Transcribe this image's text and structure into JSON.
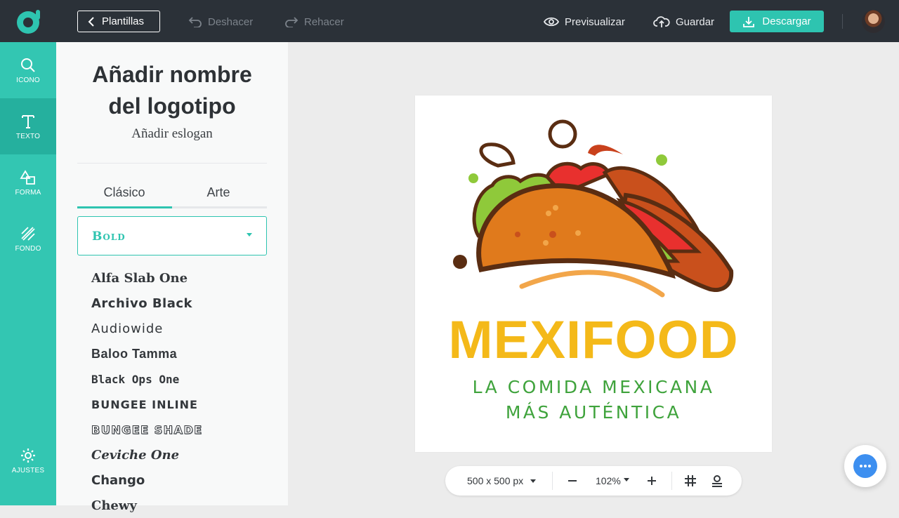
{
  "topbar": {
    "back_label": "Plantillas",
    "undo_label": "Deshacer",
    "redo_label": "Rehacer",
    "preview_label": "Previsualizar",
    "save_label": "Guardar",
    "download_label": "Descargar",
    "accent_color": "#2ec4b0"
  },
  "rail": {
    "items": [
      {
        "label": "ICONO",
        "icon": "search-icon"
      },
      {
        "label": "TEXTO",
        "icon": "text-icon"
      },
      {
        "label": "FORMA",
        "icon": "shapes-icon"
      },
      {
        "label": "FONDO",
        "icon": "background-icon"
      }
    ],
    "settings_label": "AJUSTES"
  },
  "panel": {
    "title_line1": "Añadir nombre",
    "title_line2": "del logotipo",
    "slogan": "Añadir eslogan",
    "tabs": [
      "Clásico",
      "Arte"
    ],
    "selected_category": "Bold",
    "fonts": [
      "Alfa Slab One",
      "Archivo Black",
      "Audiowide",
      "Baloo Tamma",
      "Black Ops One",
      "BUNGEE INLINE",
      "BUNGEE SHADE",
      "Ceviche One",
      "Chango",
      "Chewy"
    ]
  },
  "artboard": {
    "brand_name": "MEXIFOOD",
    "slogan_line1": "LA COMIDA MEXICANA",
    "slogan_line2": "MÁS AUTÉNTICA",
    "brand_color": "#f4b919",
    "slogan_color": "#3fa33c"
  },
  "bottombar": {
    "size_label": "500 x 500 px",
    "zoom_label": "102%"
  }
}
